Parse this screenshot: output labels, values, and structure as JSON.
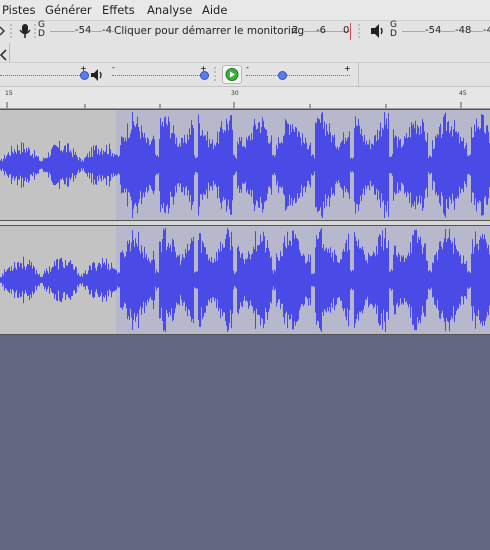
{
  "menu": {
    "items": [
      "Pistes",
      "Générer",
      "Effets",
      "Analyse",
      "Aide"
    ]
  },
  "record_meter": {
    "icon": "microphone-icon",
    "channel_top": "G",
    "channel_bottom": "D",
    "scale": [
      "-54",
      "-4"
    ],
    "monitor_label": "Cliquer pour démarrer le monitoring",
    "scale_right": [
      "2",
      "-6",
      "0"
    ]
  },
  "playback_meter": {
    "icon": "speaker-icon",
    "channel_top": "G",
    "channel_bottom": "D",
    "scale": [
      "-54",
      "-48",
      "-4"
    ]
  },
  "mixer": {
    "recording_slider": {
      "min_label": "-",
      "max_label": "+",
      "level": 0.95
    },
    "playback_slider": {
      "min_label": "-",
      "max_label": "+",
      "level": 0.97
    },
    "speed_slider": {
      "min_label": "-",
      "max_label": "+",
      "level": 0.3
    }
  },
  "ruler": {
    "ticks": [
      "15",
      "30",
      "45"
    ]
  },
  "colors": {
    "waveform": "#4a4ae6",
    "selection": "#6464d8",
    "track_bg": "#c3c3c3",
    "empty_area": "#626680"
  }
}
